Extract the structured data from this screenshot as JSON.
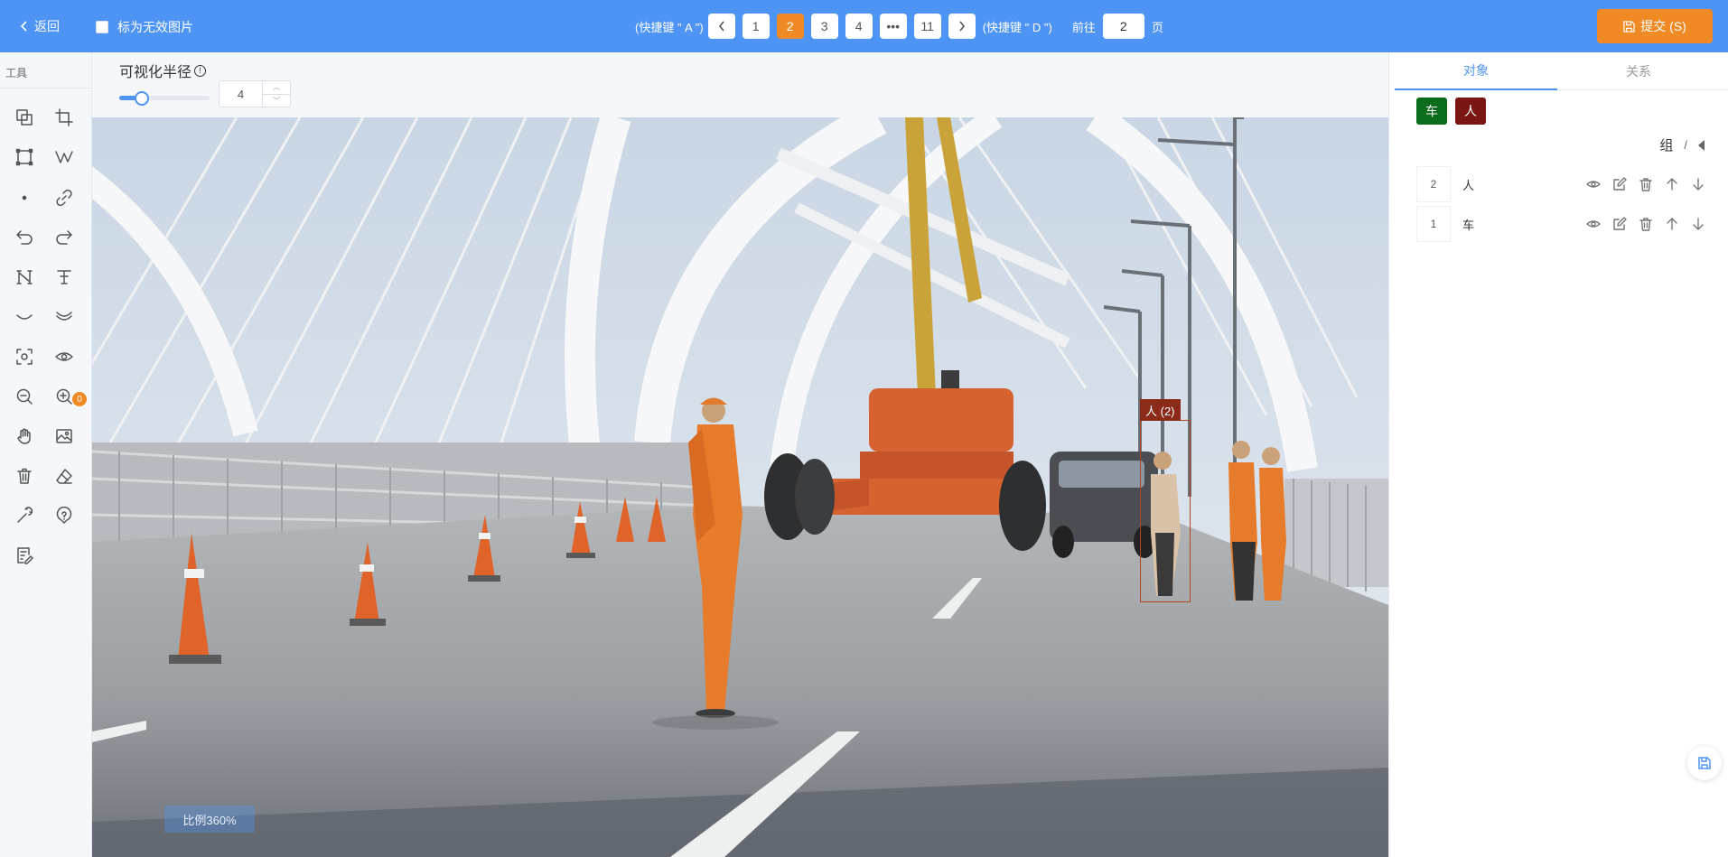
{
  "topbar": {
    "back_label": "返回",
    "invalid_label": "标为无效图片",
    "prev_hint": "(快捷键 \" A \")",
    "next_hint": "(快捷键 \" D \")",
    "pages": [
      "1",
      "2",
      "3",
      "4",
      "•••",
      "11"
    ],
    "current_page": "2",
    "goto_prefix": "前往",
    "goto_value": "2",
    "goto_suffix": "页",
    "submit_label": "提交 (S)"
  },
  "tools": {
    "title": "工具",
    "eye_badge": "0"
  },
  "canvas": {
    "radius_label": "可视化半径",
    "radius_info": "!",
    "radius_value": "4",
    "radius_fraction": 0.25,
    "bbox_label": "人 (2)",
    "scale_label": "比例360%"
  },
  "panel": {
    "tabs": [
      "对象",
      "关系"
    ],
    "tags": [
      {
        "label": "车",
        "color": "#0a6b1a"
      },
      {
        "label": "人",
        "color": "#7a1714"
      }
    ],
    "group_label": "组",
    "group_sep": "/",
    "objects": [
      {
        "index": "2",
        "name": "人"
      },
      {
        "index": "1",
        "name": "车"
      }
    ]
  },
  "colors": {
    "primary": "#4e94f5",
    "accent": "#f08a24",
    "bbox": "#b3451d"
  }
}
